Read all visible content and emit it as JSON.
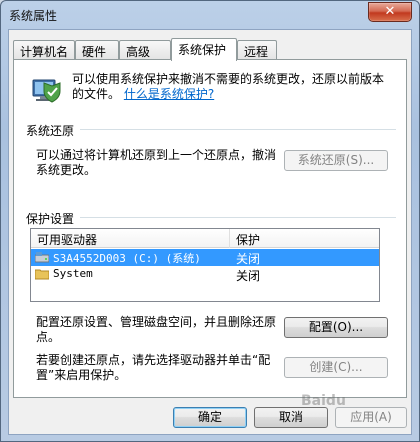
{
  "window": {
    "title": "系统属性",
    "close_glyph": "✕"
  },
  "tabs": [
    {
      "label": "计算机名",
      "active": false
    },
    {
      "label": "硬件",
      "active": false
    },
    {
      "label": "高级",
      "active": false
    },
    {
      "label": "系统保护",
      "active": true
    },
    {
      "label": "远程",
      "active": false
    }
  ],
  "intro": {
    "text": "可以使用系统保护来撤消不需要的系统更改，还原以前版本的文件。",
    "link": "什么是系统保护?",
    "icon": "shield-computer-icon"
  },
  "restore_group": {
    "label": "系统还原",
    "description": "可以通过将计算机还原到上一个还原点，撤消系统更改。",
    "button": "系统还原(S)...",
    "button_enabled": false
  },
  "protection_group": {
    "label": "保护设置",
    "columns": [
      "可用驱动器",
      "保护"
    ],
    "drives": [
      {
        "name": "S3A4552D003 (C:) (系统)",
        "status": "关闭",
        "icon": "drive-icon",
        "selected": true
      },
      {
        "name": "System",
        "status": "关闭",
        "icon": "folder-icon",
        "selected": false
      }
    ],
    "configure_text": "配置还原设置、管理磁盘空间，并且删除还原点。",
    "configure_button": "配置(O)...",
    "create_text": "若要创建还原点，请先选择驱动器并单击“配置”来启用保护。",
    "create_button": "创建(C)...",
    "create_enabled": false
  },
  "footer": {
    "ok": "确定",
    "cancel": "取消",
    "apply": "应用(A)",
    "apply_enabled": false
  },
  "watermark": "Baidu"
}
